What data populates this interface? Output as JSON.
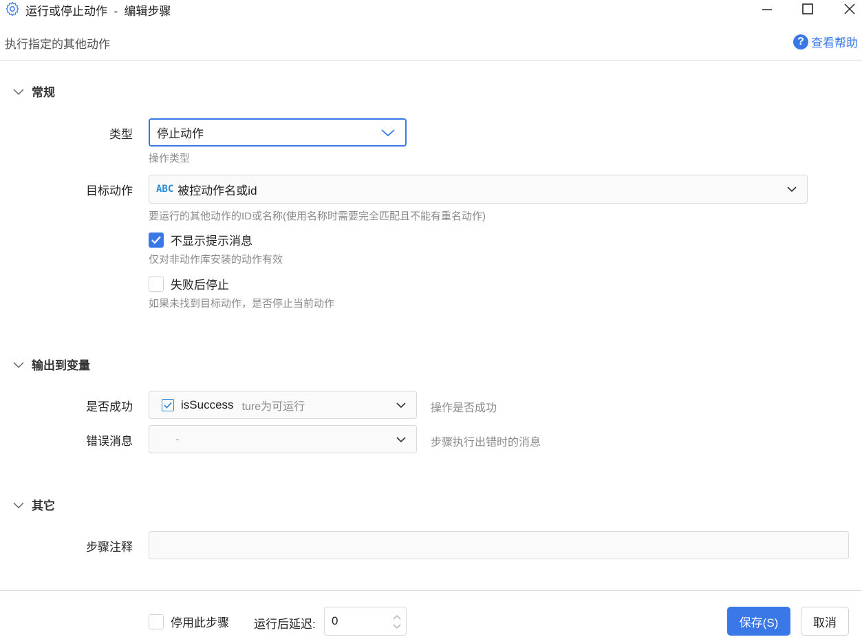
{
  "window": {
    "title": "运行或停止动作  -  编辑步骤",
    "subtitle": "执行指定的其他动作",
    "help_label": "查看帮助"
  },
  "sections": {
    "general": "常规",
    "output": "输出到变量",
    "other": "其它"
  },
  "general": {
    "type_label": "类型",
    "type_value": "停止动作",
    "type_hint": "操作类型",
    "target_label": "目标动作",
    "target_badge": "ABC",
    "target_value": "被控动作名或id",
    "target_hint": "要运行的其他动作的ID或名称(使用名称时需要完全匹配且不能有重名动作)",
    "no_prompt_label": "不显示提示消息",
    "no_prompt_checked": true,
    "no_prompt_hint": "仅对非动作库安装的动作有效",
    "stop_on_fail_label": "失败后停止",
    "stop_on_fail_checked": false,
    "stop_on_fail_hint": "如果未找到目标动作，是否停止当前动作"
  },
  "output": {
    "success_label": "是否成功",
    "success_var": "isSuccess",
    "success_var_desc": "ture为可运行",
    "success_hint": "操作是否成功",
    "error_label": "错误消息",
    "error_value": "-",
    "error_hint": "步骤执行出错时的消息"
  },
  "other": {
    "note_label": "步骤注释",
    "note_value": ""
  },
  "footer": {
    "disable_label": "停用此步骤",
    "delay_label": "运行后延迟:",
    "delay_value": "0",
    "save_label": "保存(S)",
    "cancel_label": "取消"
  },
  "colors": {
    "accent": "#3a78e8",
    "hint": "#8a8a8a",
    "border": "#d9d9d9"
  }
}
